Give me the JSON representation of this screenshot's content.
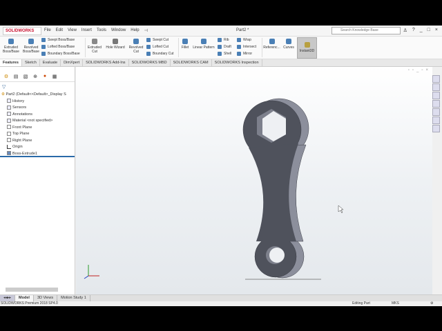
{
  "app": {
    "logo": "SOLIDWORKS",
    "title": "Part2 *",
    "search_placeholder": "Search Knowledge Base"
  },
  "menu": [
    "File",
    "Edit",
    "View",
    "Insert",
    "Tools",
    "Window",
    "Help"
  ],
  "ribbon": {
    "extruded_boss": "Extruded Boss/Base",
    "revolved_boss": "Revolved Boss/Base",
    "swept_boss": "Swept Boss/Base",
    "lofted_boss": "Lofted Boss/Base",
    "boundary_boss": "Boundary Boss/Base",
    "extruded_cut": "Extruded Cut",
    "hole_wizard": "Hole Wizard",
    "revolved_cut": "Revolved Cut",
    "swept_cut": "Swept Cut",
    "lofted_cut": "Lofted Cut",
    "boundary_cut": "Boundary Cut",
    "fillet": "Fillet",
    "linear_pattern": "Linear Pattern",
    "rib": "Rib",
    "draft": "Draft",
    "shell": "Shell",
    "wrap": "Wrap",
    "intersect": "Intersect",
    "mirror": "Mirror",
    "reference": "Referenc...",
    "curves": "Curves",
    "instant3d": "Instant3D"
  },
  "tabs": [
    "Features",
    "Sketch",
    "Evaluate",
    "DimXpert",
    "SOLIDWORKS Add-Ins",
    "SOLIDWORKS MBD",
    "SOLIDWORKS CAM",
    "SOLIDWORKS Inspection"
  ],
  "tree": {
    "root": "Part2  (Default<<Default>_Display S",
    "items": [
      "History",
      "Sensors",
      "Annotations",
      "Material <not specified>",
      "Front Plane",
      "Top Plane",
      "Right Plane",
      "Origin",
      "Boss-Extrude1"
    ]
  },
  "bottom_tabs": [
    "Model",
    "3D Views",
    "Motion Study 1"
  ],
  "status": {
    "version": "SOLIDWORKS Premium 2018 SP4.0",
    "mode": "Editing Part",
    "units": "MKS"
  },
  "colors": {
    "part_face": "#4f525c",
    "part_side": "#8c8f9c",
    "accent": "#c8102e"
  }
}
